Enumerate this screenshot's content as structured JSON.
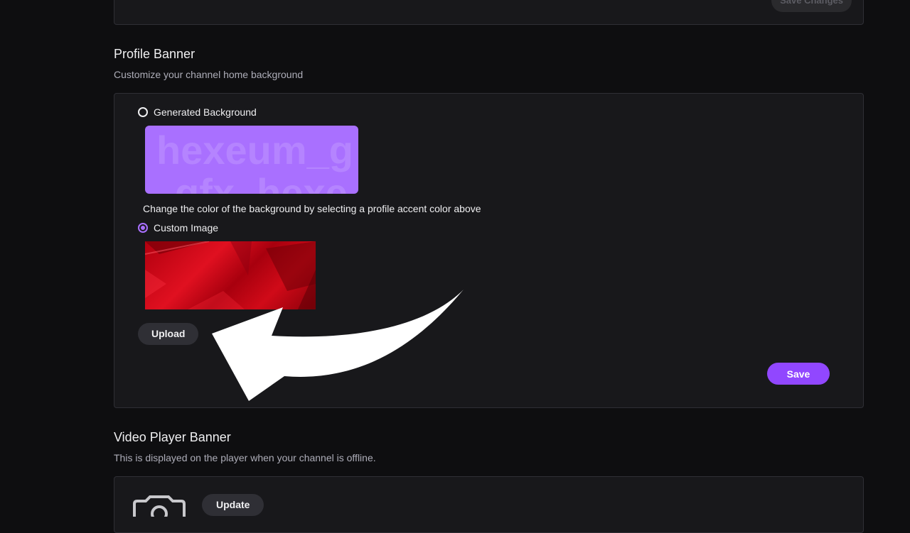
{
  "top": {
    "save_changes_label": "Save Changes"
  },
  "profile_banner": {
    "title": "Profile Banner",
    "subtitle": "Customize your channel home background",
    "generated_option_label": "Generated Background",
    "generated_preview_line1": "hexeum_g",
    "generated_preview_line2": "gfx_hexe",
    "generated_hint": "Change the color of the background by selecting a profile accent color above",
    "custom_option_label": "Custom Image",
    "selected_option": "Custom Image",
    "upload_label": "Upload",
    "save_label": "Save"
  },
  "video_player_banner": {
    "title": "Video Player Banner",
    "subtitle": "This is displayed on the player when your channel is offline.",
    "update_label": "Update"
  },
  "icons": [
    "radio-unchecked",
    "radio-checked",
    "camera-icon",
    "arrow-annotation"
  ],
  "colors": {
    "accent": "#9147ff",
    "accent_light": "#a970ff",
    "banner_red": "#d00a18",
    "page_bg": "#0e0e10",
    "card_bg": "#18181b"
  }
}
